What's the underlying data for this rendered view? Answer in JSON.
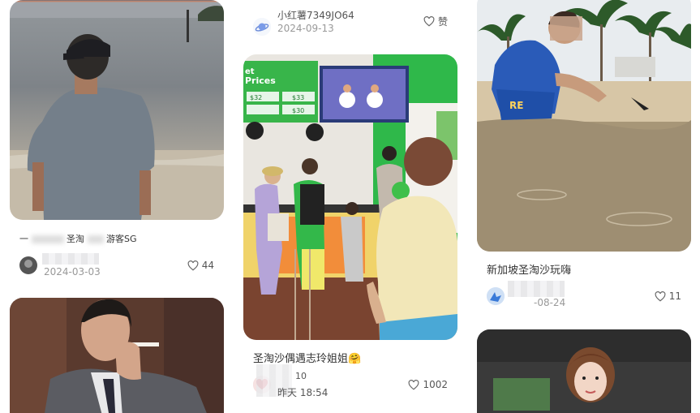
{
  "feed": {
    "col1": {
      "card1": {
        "title_left": "一",
        "title_mid": "圣淘",
        "title_right": "游客SG",
        "date": "2024-03-03",
        "likes": "44"
      }
    },
    "col2": {
      "card0": {
        "author": "小红薯7349JO64",
        "date": "2024-09-13",
        "like_label": "赞"
      },
      "card1": {
        "title": "圣淘沙偶遇志玲姐姐",
        "emoji": "🤗",
        "author_partial": "10",
        "date": "昨天 18:54",
        "likes": "1002",
        "banner_text": "Prices",
        "banner_text2": "et",
        "price1": "$33",
        "price2": "$30",
        "price3": "$32"
      }
    },
    "col3": {
      "card1": {
        "title": "新加坡圣淘沙玩嗨",
        "date": "-08-24",
        "likes": "11",
        "shirt_text": "RE"
      }
    }
  },
  "colors": {
    "text": "#333333",
    "muted": "#999999",
    "accent": "#ff2442",
    "green": "#2fb84a"
  }
}
